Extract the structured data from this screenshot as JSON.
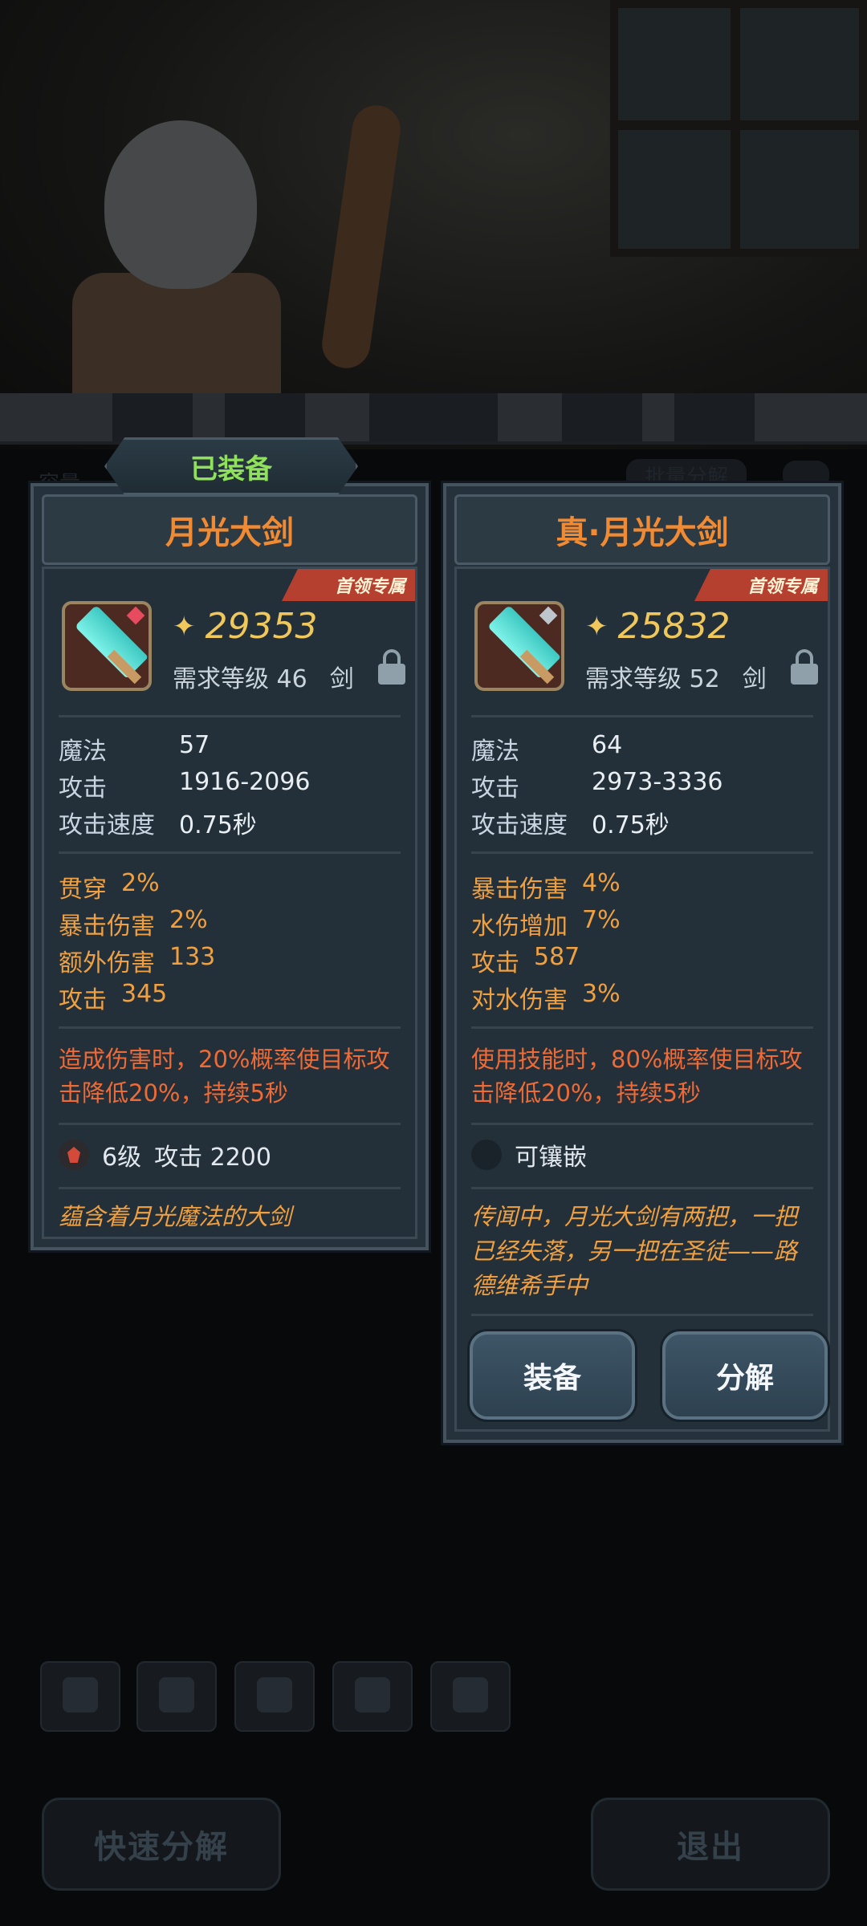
{
  "header": {
    "equipped_tab": "已装备"
  },
  "background_ui": {
    "label_left": "容量",
    "label_right": "批量分解",
    "quick_decompose": "快速分解",
    "exit": "退出"
  },
  "left_card": {
    "name": "月光大剑",
    "tag": "首领专属",
    "power": "29353",
    "req_level": "需求等级 46",
    "weapon_type": "剑",
    "base_stats": [
      {
        "k": "魔法",
        "v": "57"
      },
      {
        "k": "攻击",
        "v": "1916-2096"
      },
      {
        "k": "攻击速度",
        "v": "0.75秒"
      }
    ],
    "bonus_stats": [
      {
        "k": "贯穿",
        "v": "2%"
      },
      {
        "k": "暴击伤害",
        "v": "2%"
      },
      {
        "k": "额外伤害",
        "v": "133"
      },
      {
        "k": "攻击",
        "v": "345"
      }
    ],
    "effect": "造成伤害时，20%概率使目标攻击降低20%，持续5秒",
    "socket_level": "6级",
    "socket_stat": "攻击 2200",
    "lore": "蕴含着月光魔法的大剑",
    "gem_color": "#e84a5f"
  },
  "right_card": {
    "name": "真·月光大剑",
    "tag": "首领专属",
    "power": "25832",
    "req_level": "需求等级 52",
    "weapon_type": "剑",
    "base_stats": [
      {
        "k": "魔法",
        "v": "64"
      },
      {
        "k": "攻击",
        "v": "2973-3336"
      },
      {
        "k": "攻击速度",
        "v": "0.75秒"
      }
    ],
    "bonus_stats": [
      {
        "k": "暴击伤害",
        "v": "4%"
      },
      {
        "k": "水伤增加",
        "v": "7%"
      },
      {
        "k": "攻击",
        "v": "587"
      },
      {
        "k": "对水伤害",
        "v": "3%"
      }
    ],
    "effect": "使用技能时，80%概率使目标攻击降低20%，持续5秒",
    "socket_text": "可镶嵌",
    "lore": "传闻中，月光大剑有两把，一把已经失落，另一把在圣徒——路德维希手中",
    "gem_color": "#bcc6cc",
    "equip_button": "装备",
    "decompose_button": "分解"
  },
  "colors": {
    "accent_orange": "#f08a33",
    "effect_red": "#ee6a36",
    "power_gold": "#f0c75a",
    "equipped_green": "#8fe05a"
  }
}
